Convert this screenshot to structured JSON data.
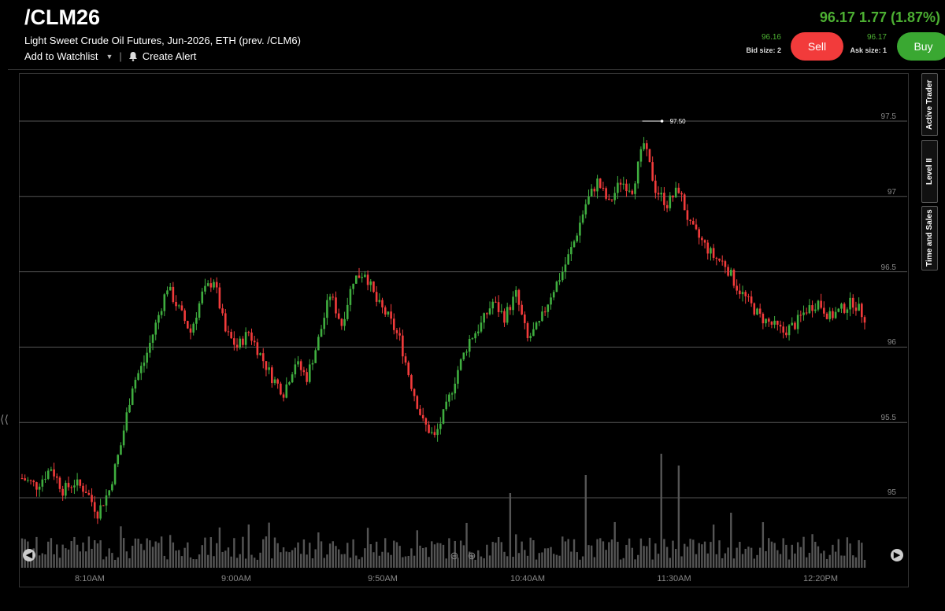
{
  "header": {
    "symbol": "/CLM26",
    "description": "Light Sweet Crude Oil Futures, Jun-2026, ETH (prev. /CLM6)",
    "add_watchlist": "Add to Watchlist",
    "separator": "|",
    "create_alert": "Create Alert",
    "price_summary": "96.17 1.77 (1.87%)",
    "bid_price": "96.16",
    "bid_size": "Bid size: 2",
    "sell_label": "Sell",
    "ask_price": "96.17",
    "ask_size": "Ask size: 1",
    "buy_label": "Buy"
  },
  "side_tabs": {
    "active_trader": "Active Trader",
    "level_ii": "Level II",
    "time_and_sales": "Time and Sales"
  },
  "chart": {
    "high_marker": "97.50",
    "y_ticks": [
      "97.5",
      "97",
      "96.5",
      "96",
      "95.5",
      "95"
    ],
    "x_ticks": [
      "8:10AM",
      "9:00AM",
      "9:50AM",
      "10:40AM",
      "11:30AM",
      "12:20PM"
    ],
    "up_color": "#3fae3f",
    "down_color": "#f23b3b",
    "volume_color": "#555555"
  },
  "chart_data": {
    "type": "candlestick",
    "y_ticks": [
      95,
      95.5,
      96,
      96.5,
      97,
      97.5
    ],
    "ylim": [
      94.5,
      97.65
    ],
    "x_tick_labels": [
      "8:10AM",
      "9:00AM",
      "9:50AM",
      "10:40AM",
      "11:30AM",
      "12:20PM"
    ],
    "high_annotation": 97.5,
    "price_path": [
      [
        0,
        95.13
      ],
      [
        5,
        95.08
      ],
      [
        10,
        95.2
      ],
      [
        14,
        95.05
      ],
      [
        18,
        95.1
      ],
      [
        22,
        95.05
      ],
      [
        26,
        94.9
      ],
      [
        30,
        95.05
      ],
      [
        34,
        95.35
      ],
      [
        38,
        95.75
      ],
      [
        42,
        95.9
      ],
      [
        46,
        96.15
      ],
      [
        50,
        96.4
      ],
      [
        54,
        96.25
      ],
      [
        58,
        96.1
      ],
      [
        62,
        96.35
      ],
      [
        66,
        96.45
      ],
      [
        70,
        96.1
      ],
      [
        74,
        96.0
      ],
      [
        78,
        96.1
      ],
      [
        82,
        95.95
      ],
      [
        86,
        95.8
      ],
      [
        90,
        95.7
      ],
      [
        94,
        95.9
      ],
      [
        98,
        95.8
      ],
      [
        102,
        96.05
      ],
      [
        106,
        96.35
      ],
      [
        110,
        96.15
      ],
      [
        114,
        96.45
      ],
      [
        118,
        96.5
      ],
      [
        122,
        96.3
      ],
      [
        126,
        96.2
      ],
      [
        130,
        96.05
      ],
      [
        134,
        95.75
      ],
      [
        138,
        95.5
      ],
      [
        142,
        95.4
      ],
      [
        146,
        95.6
      ],
      [
        150,
        95.85
      ],
      [
        154,
        96.05
      ],
      [
        158,
        96.15
      ],
      [
        162,
        96.3
      ],
      [
        166,
        96.2
      ],
      [
        170,
        96.35
      ],
      [
        174,
        96.05
      ],
      [
        178,
        96.15
      ],
      [
        182,
        96.35
      ],
      [
        186,
        96.5
      ],
      [
        190,
        96.7
      ],
      [
        194,
        96.95
      ],
      [
        198,
        97.1
      ],
      [
        202,
        96.95
      ],
      [
        206,
        97.1
      ],
      [
        210,
        97.05
      ],
      [
        214,
        97.35
      ],
      [
        218,
        97.05
      ],
      [
        222,
        96.95
      ],
      [
        226,
        97.05
      ],
      [
        230,
        96.8
      ],
      [
        234,
        96.7
      ],
      [
        238,
        96.6
      ],
      [
        242,
        96.55
      ],
      [
        246,
        96.4
      ],
      [
        250,
        96.3
      ],
      [
        254,
        96.2
      ],
      [
        258,
        96.15
      ],
      [
        262,
        96.1
      ],
      [
        266,
        96.15
      ],
      [
        270,
        96.25
      ],
      [
        274,
        96.3
      ],
      [
        278,
        96.2
      ],
      [
        282,
        96.25
      ],
      [
        286,
        96.3
      ],
      [
        290,
        96.2
      ],
      [
        294,
        96.15
      ]
    ]
  }
}
